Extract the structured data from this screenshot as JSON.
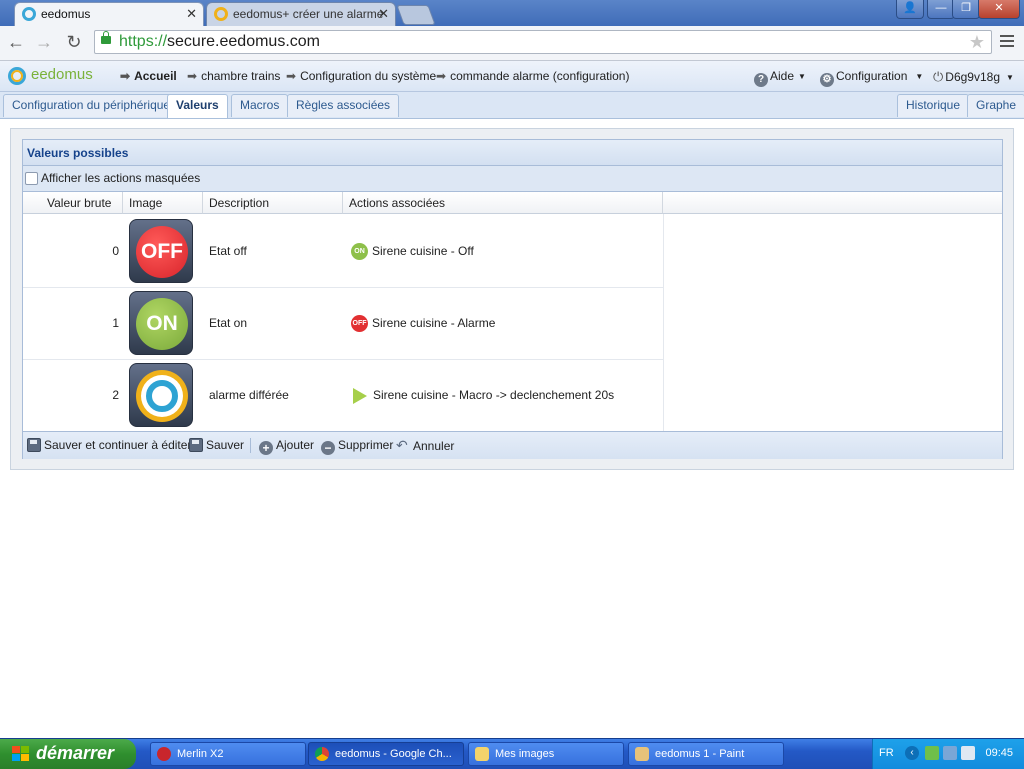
{
  "browser": {
    "tabs": [
      {
        "title": "eedomus",
        "active": true
      },
      {
        "title": "eedomus+ créer une alarme",
        "active": false
      }
    ],
    "close_glyph": "✕",
    "url_scheme": "https://",
    "url_host": "secure.eedomus.com",
    "window_buttons": {
      "user": "👤",
      "minimize": "—",
      "restore": "❐",
      "close": "✕"
    }
  },
  "app": {
    "logo_text": "eedomus",
    "breadcrumb": [
      "Accueil",
      "chambre trains",
      "Configuration du système",
      "commande alarme (configuration)"
    ],
    "help_label": "Aide",
    "config_label": "Configuration",
    "user_label": "D6g9v18g"
  },
  "subtabs": {
    "left": [
      "Configuration du périphérique",
      "Valeurs",
      "Macros",
      "Règles associées"
    ],
    "active": "Valeurs",
    "right": [
      "Historique",
      "Graphe"
    ]
  },
  "panel": {
    "title": "Valeurs possibles",
    "show_hidden_label": "Afficher les actions masquées",
    "show_hidden_checked": false,
    "columns": [
      "Valeur brute",
      "Image",
      "Description",
      "Actions associées"
    ],
    "rows": [
      {
        "raw": "0",
        "image_icon": "off-icon",
        "image_text": "OFF",
        "description": "Etat off",
        "action_icon": "on-mini-icon",
        "action_icon_text": "ON",
        "action": "Sirene cuisine - Off"
      },
      {
        "raw": "1",
        "image_icon": "on-icon",
        "image_text": "ON",
        "description": "Etat on",
        "action_icon": "off-mini-icon",
        "action_icon_text": "OFF",
        "action": "Sirene cuisine - Alarme"
      },
      {
        "raw": "2",
        "image_icon": "eedomus-ring-icon",
        "image_text": "",
        "description": "alarme différée",
        "action_icon": "play-icon",
        "action_icon_text": "",
        "action": "Sirene cuisine - Macro -> declenchement 20s"
      }
    ],
    "footer": {
      "save_continue": "Sauver et continuer à éditer",
      "save": "Sauver",
      "add": "Ajouter",
      "delete": "Supprimer",
      "cancel": "Annuler"
    }
  },
  "taskbar": {
    "start_label": "démarrer",
    "items": [
      {
        "label": "Merlin X2",
        "active": false
      },
      {
        "label": "eedomus - Google Ch...",
        "active": true
      },
      {
        "label": "Mes images",
        "active": false
      },
      {
        "label": "eedomus 1 - Paint",
        "active": false
      }
    ],
    "language": "FR",
    "clock": "09:45"
  },
  "colors": {
    "accent_blue": "#15428b",
    "logo_green": "#7ab23a",
    "off_red": "#d8242b",
    "on_green": "#8ec04a",
    "eedomus_yellow": "#f0b11a",
    "eedomus_blue": "#2ea3d3"
  }
}
